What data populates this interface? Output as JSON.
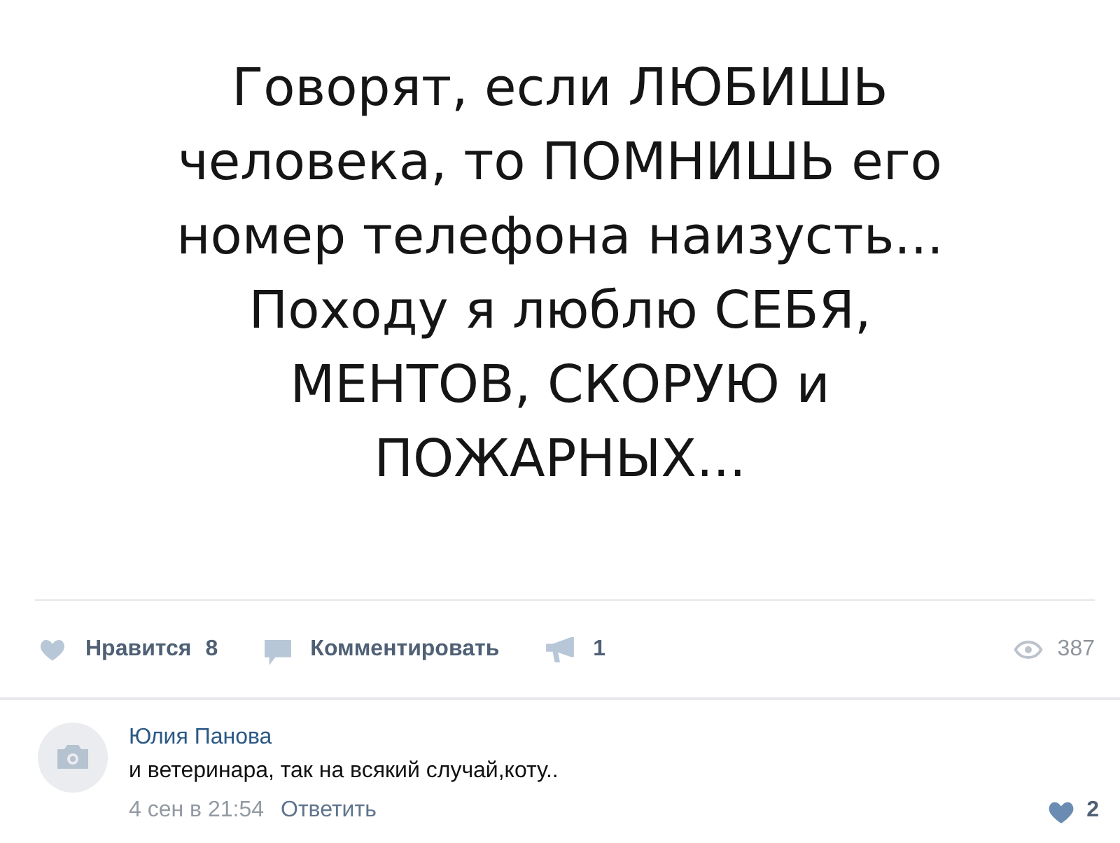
{
  "post": {
    "image_text": {
      "lines": [
        "Говорят, если ЛЮБИШЬ",
        "человека, то ПОМНИШЬ его",
        "номер телефона наизусть...",
        "Походу я люблю СЕБЯ,",
        "МЕНТОВ, СКОРУЮ и",
        "ПОЖАРНЫХ..."
      ]
    }
  },
  "actions": {
    "like": {
      "label": "Нравится",
      "count": "8"
    },
    "comment": {
      "label": "Комментировать"
    },
    "share": {
      "count": "1"
    },
    "views": {
      "count": "387"
    }
  },
  "comments": [
    {
      "author": "Юлия Панова",
      "text": "и ветеринара, так на всякий случай,коту..",
      "date": "4 сен в 21:54",
      "reply": "Ответить",
      "likes": "2"
    }
  ]
}
